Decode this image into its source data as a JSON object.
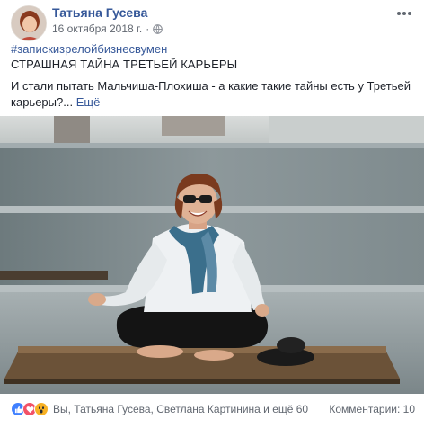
{
  "post": {
    "author": "Татьяна Гусева",
    "date": "16 октября 2018 г.",
    "hashtag": "#запискизрелойбизнесвумен",
    "title": "СТРАШНАЯ ТАЙНА ТРЕТЬЕЙ КАРЬЕРЫ",
    "body": "И стали пытать Мальчиша-Плохиша - а какие такие тайны есть у Третьей карьеры?...",
    "see_more": "Ещё"
  },
  "footer": {
    "reaction_names": "Вы, Татьяна Гусева, Светлана Картинина и ещё 60",
    "comments": "Комментарии: 10"
  },
  "icons": {
    "privacy": "globe-icon",
    "menu": "more-horizontal-icon",
    "reactions": [
      "like-icon",
      "love-icon",
      "wow-icon"
    ]
  },
  "colors": {
    "link": "#365899",
    "text": "#1d2129",
    "meta": "#616770",
    "like": "#4080ff",
    "love": "#f25268",
    "wow": "#f7b125"
  }
}
